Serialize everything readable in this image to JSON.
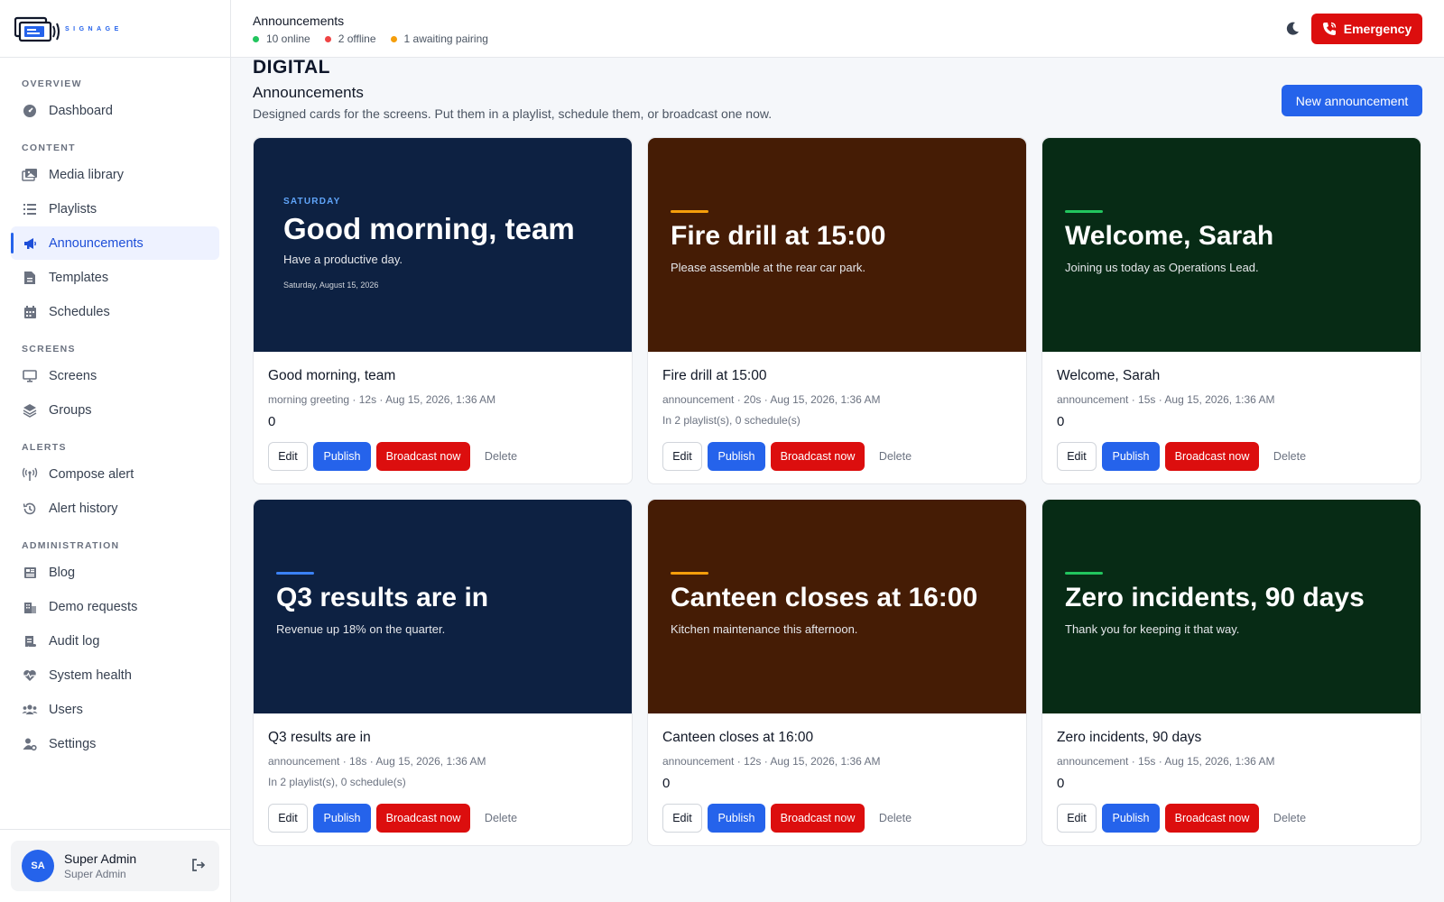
{
  "brand": {
    "name": "DIGITAL",
    "tagline": "SIGNAGE"
  },
  "sidebar": {
    "sections": [
      {
        "label": "OVERVIEW",
        "items": [
          {
            "label": "Dashboard",
            "icon": "gauge-icon"
          }
        ]
      },
      {
        "label": "CONTENT",
        "items": [
          {
            "label": "Media library",
            "icon": "images-icon"
          },
          {
            "label": "Playlists",
            "icon": "list-icon"
          },
          {
            "label": "Announcements",
            "icon": "megaphone-icon",
            "active": true
          },
          {
            "label": "Templates",
            "icon": "file-icon"
          },
          {
            "label": "Schedules",
            "icon": "calendar-icon"
          }
        ]
      },
      {
        "label": "SCREENS",
        "items": [
          {
            "label": "Screens",
            "icon": "monitor-icon"
          },
          {
            "label": "Groups",
            "icon": "layers-icon"
          }
        ]
      },
      {
        "label": "ALERTS",
        "items": [
          {
            "label": "Compose alert",
            "icon": "broadcast-icon"
          },
          {
            "label": "Alert history",
            "icon": "history-icon"
          }
        ]
      },
      {
        "label": "ADMINISTRATION",
        "items": [
          {
            "label": "Blog",
            "icon": "newspaper-icon"
          },
          {
            "label": "Demo requests",
            "icon": "building-icon"
          },
          {
            "label": "Audit log",
            "icon": "scroll-icon"
          },
          {
            "label": "System health",
            "icon": "heart-pulse-icon"
          },
          {
            "label": "Users",
            "icon": "users-icon"
          },
          {
            "label": "Settings",
            "icon": "user-gear-icon"
          }
        ]
      }
    ],
    "user": {
      "initials": "SA",
      "name": "Super Admin",
      "role": "Super Admin"
    }
  },
  "header": {
    "title": "Announcements",
    "status": [
      {
        "text": "10 online",
        "color": "#22c55e"
      },
      {
        "text": "2 offline",
        "color": "#ef4444"
      },
      {
        "text": "1 awaiting pairing",
        "color": "#f59e0b"
      }
    ],
    "emergency_label": "Emergency"
  },
  "page": {
    "title": "Announcements",
    "subtitle": "Designed cards for the screens. Put them in a playlist, schedule them, or broadcast one now.",
    "new_button": "New announcement"
  },
  "actions": {
    "edit": "Edit",
    "publish": "Publish",
    "broadcast": "Broadcast now",
    "delete": "Delete"
  },
  "cards": [
    {
      "theme": "navy",
      "kicker": "SATURDAY",
      "preview_title": "Good morning, team",
      "preview_sub": "Have a productive day.",
      "preview_date": "Saturday, August 15, 2026",
      "title": "Good morning, team",
      "meta": "morning greeting · 12s · Aug 15, 2026, 1:36 AM",
      "usage": "",
      "count": "0"
    },
    {
      "theme": "brown",
      "accent": "#f59e0b",
      "preview_title": "Fire drill at 15:00",
      "preview_sub": "Please assemble at the rear car park.",
      "title": "Fire drill at 15:00",
      "meta": "announcement · 20s · Aug 15, 2026, 1:36 AM",
      "usage": "In 2 playlist(s), 0 schedule(s)",
      "count": ""
    },
    {
      "theme": "green",
      "accent": "#22c55e",
      "preview_title": "Welcome, Sarah",
      "preview_sub": "Joining us today as Operations Lead.",
      "title": "Welcome, Sarah",
      "meta": "announcement · 15s · Aug 15, 2026, 1:36 AM",
      "usage": "",
      "count": "0"
    },
    {
      "theme": "navy",
      "accent": "#3b82f6",
      "preview_title": "Q3 results are in",
      "preview_sub": "Revenue up 18% on the quarter.",
      "title": "Q3 results are in",
      "meta": "announcement · 18s · Aug 15, 2026, 1:36 AM",
      "usage": "In 2 playlist(s), 0 schedule(s)",
      "count": ""
    },
    {
      "theme": "brown",
      "accent": "#f59e0b",
      "preview_title": "Canteen closes at 16:00",
      "preview_sub": "Kitchen maintenance this afternoon.",
      "title": "Canteen closes at 16:00",
      "meta": "announcement · 12s · Aug 15, 2026, 1:36 AM",
      "usage": "",
      "count": "0"
    },
    {
      "theme": "green",
      "accent": "#22c55e",
      "preview_title": "Zero incidents, 90 days",
      "preview_sub": "Thank you for keeping it that way.",
      "title": "Zero incidents, 90 days",
      "meta": "announcement · 15s · Aug 15, 2026, 1:36 AM",
      "usage": "",
      "count": "0"
    }
  ]
}
